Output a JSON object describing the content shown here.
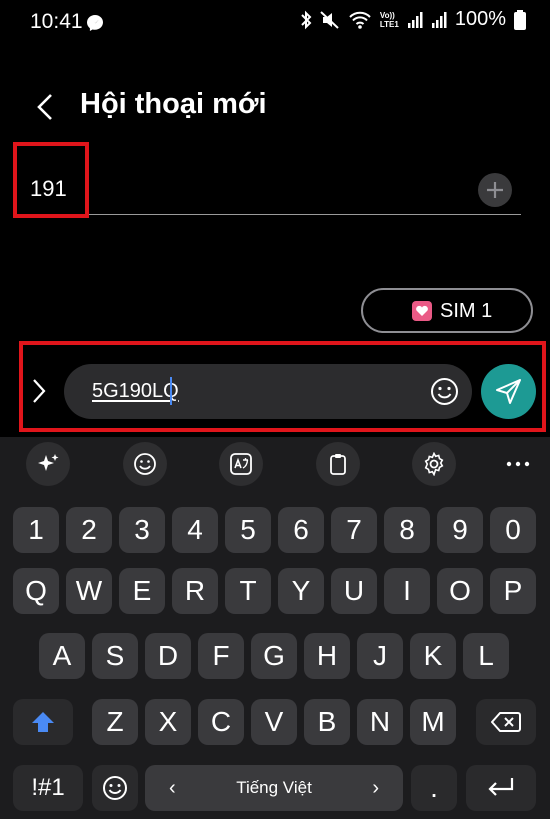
{
  "status_bar": {
    "time": "10:41",
    "lte_label": "LTE1",
    "volte_label": "Vo))",
    "battery": "100%"
  },
  "header": {
    "title": "Hội thoại mới"
  },
  "recipient": {
    "value": "191"
  },
  "sim": {
    "label": "SIM 1"
  },
  "compose": {
    "message": "5G190LQ"
  },
  "keyboard": {
    "toolbar": [
      "ai-sparkle-icon",
      "emoji-icon",
      "translate-icon",
      "clipboard-icon",
      "settings-icon",
      "more-icon"
    ],
    "number_row": [
      "1",
      "2",
      "3",
      "4",
      "5",
      "6",
      "7",
      "8",
      "9",
      "0"
    ],
    "row1": [
      "Q",
      "W",
      "E",
      "R",
      "T",
      "Y",
      "U",
      "I",
      "O",
      "P"
    ],
    "row2": [
      "A",
      "S",
      "D",
      "F",
      "G",
      "H",
      "J",
      "K",
      "L"
    ],
    "row3": [
      "Z",
      "X",
      "C",
      "V",
      "B",
      "N",
      "M"
    ],
    "symbols_label": "!#1",
    "space_label": "Tiếng Việt",
    "period_label": "."
  },
  "colors": {
    "highlight": "#e0151b",
    "send": "#1d9a94",
    "shift": "#4a8af4"
  }
}
